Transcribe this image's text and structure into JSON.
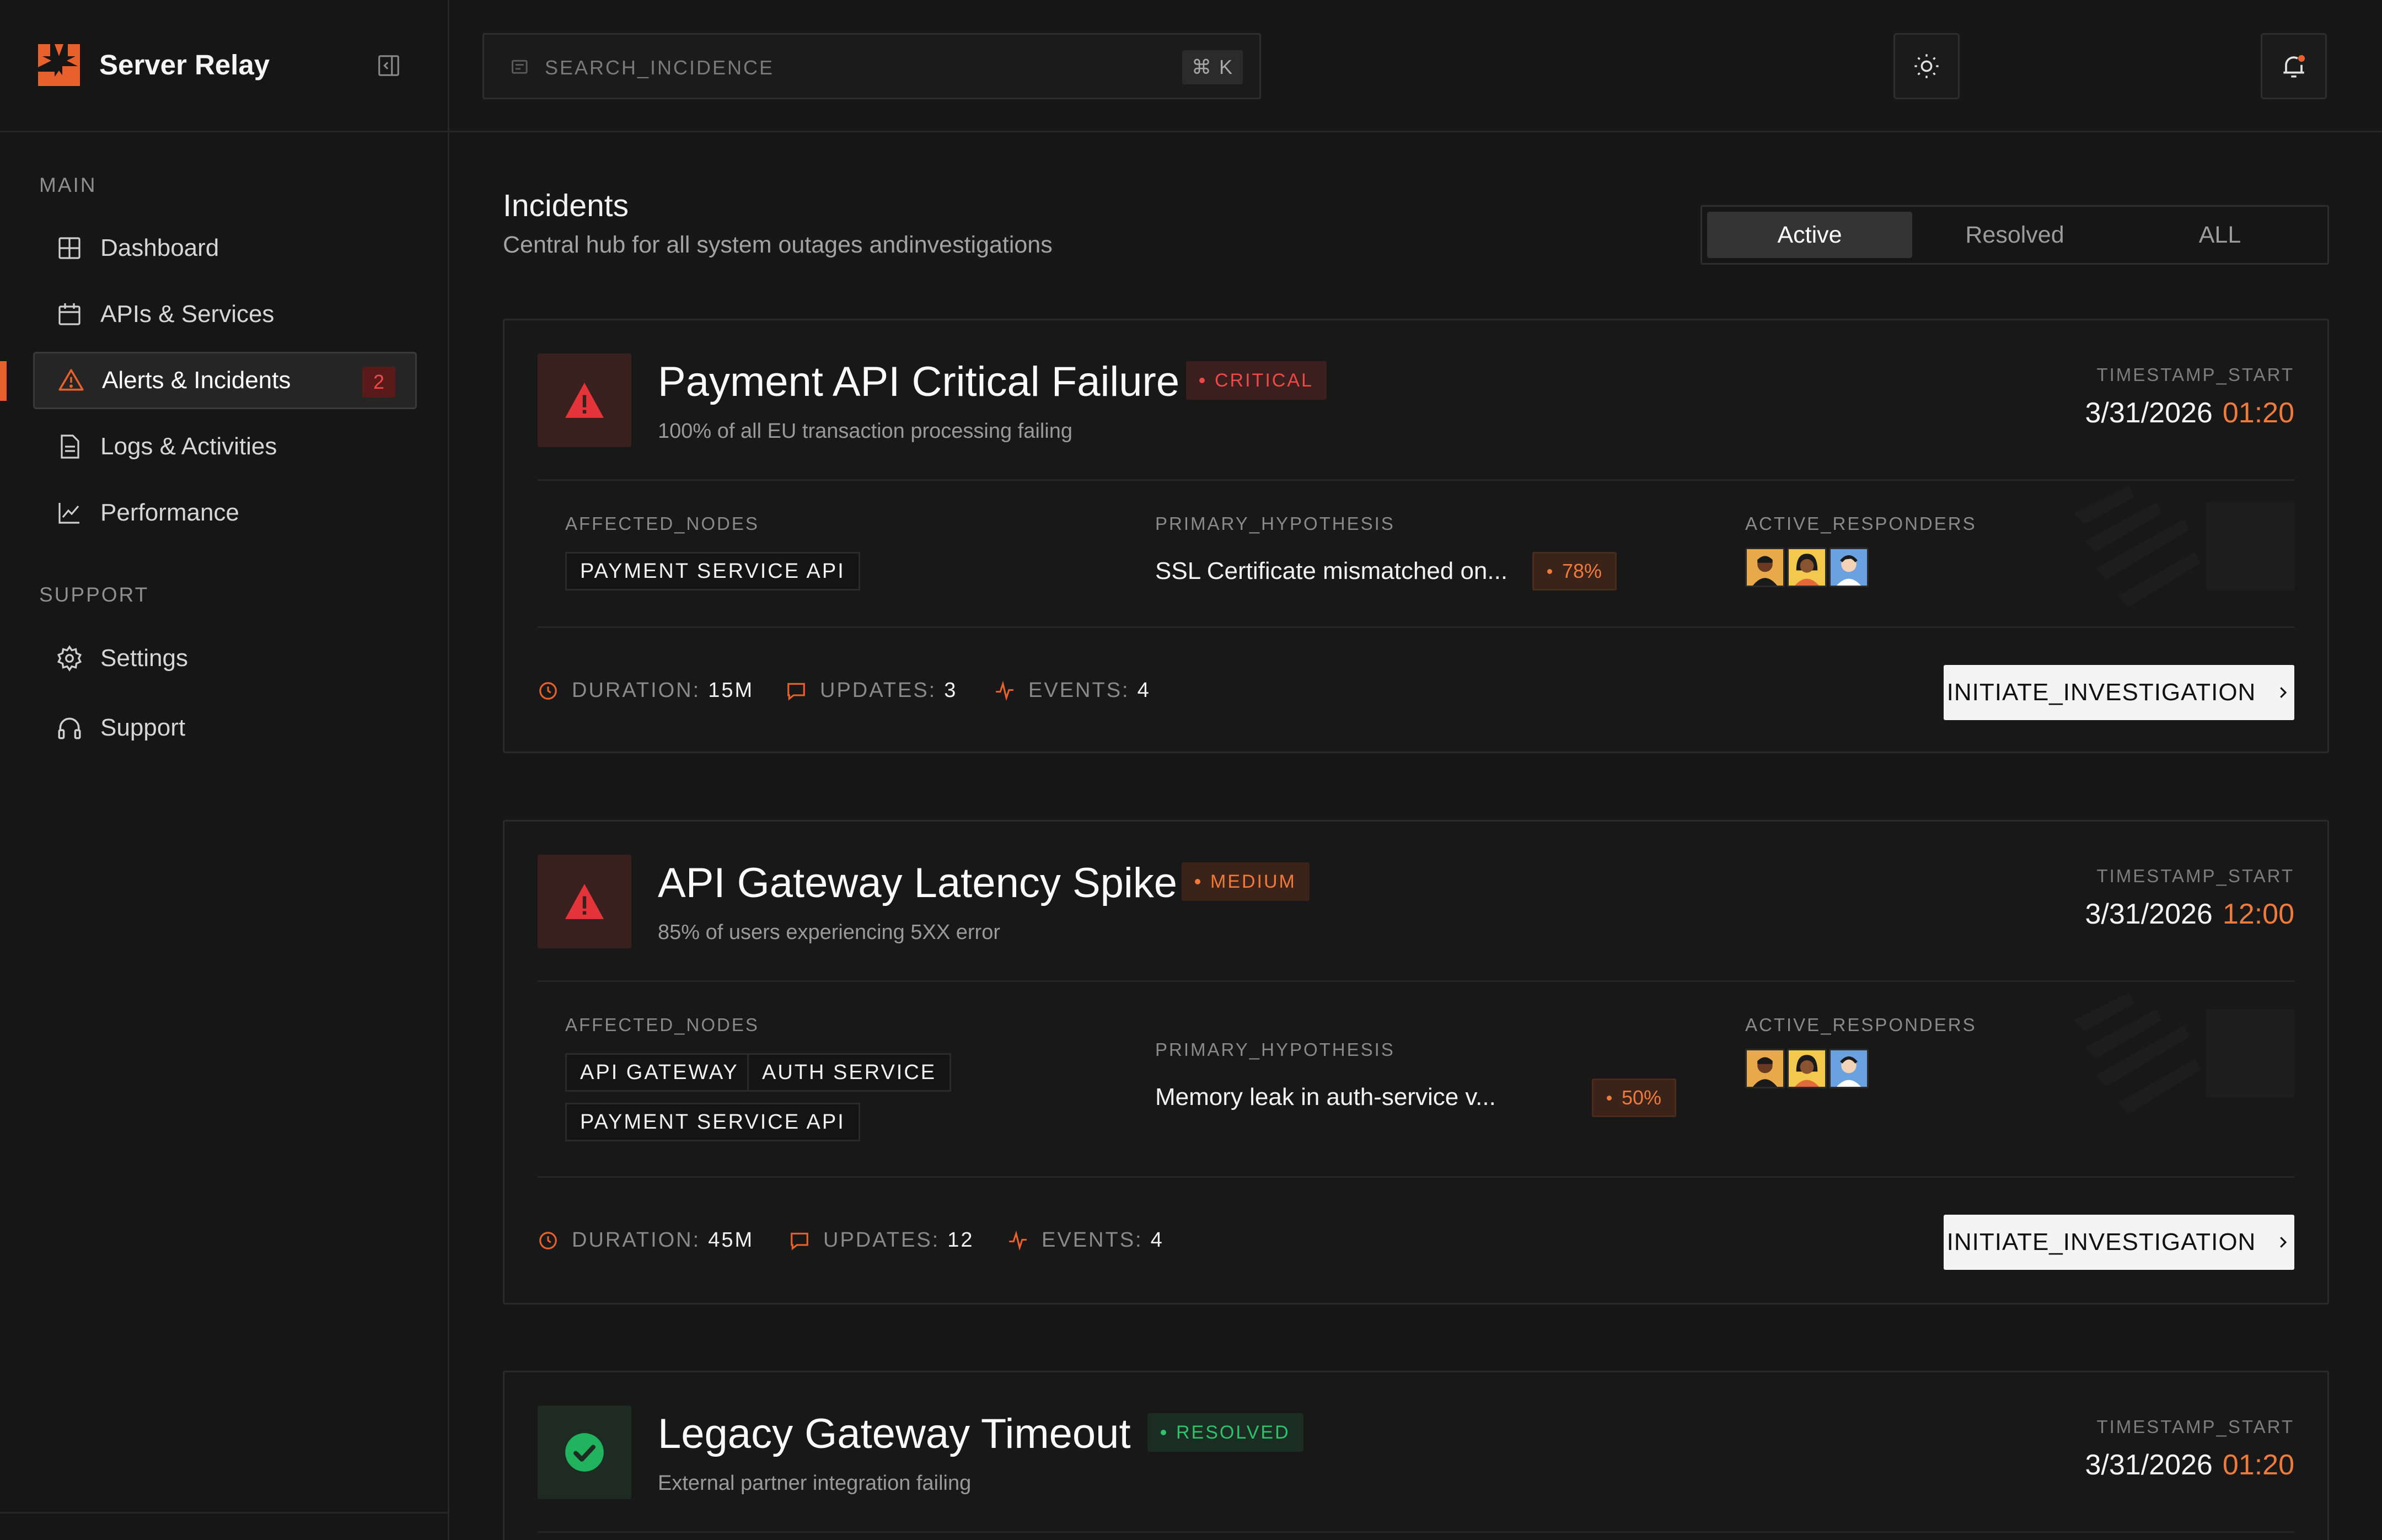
{
  "app": {
    "name": "Server Relay",
    "brand_color": "#e8612c"
  },
  "search": {
    "placeholder": "SEARCH_INCIDENCE",
    "shortcut": "⌘ K"
  },
  "sidebar": {
    "main_label": "MAIN",
    "support_label": "SUPPORT",
    "items": [
      {
        "label": "Dashboard",
        "icon": "grid-icon"
      },
      {
        "label": "APIs & Services",
        "icon": "calendar-icon"
      },
      {
        "label": "Alerts & Incidents",
        "icon": "warning-icon",
        "badge": "2",
        "active": true
      },
      {
        "label": "Logs & Activities",
        "icon": "document-icon"
      },
      {
        "label": "Performance",
        "icon": "chart-icon"
      }
    ],
    "support_items": [
      {
        "label": "Settings",
        "icon": "gear-icon"
      },
      {
        "label": "Support",
        "icon": "headphones-icon"
      }
    ]
  },
  "header": {
    "title": "Incidents",
    "subtitle": "Central hub for all system outages andinvestigations",
    "tabs": [
      "Active",
      "Resolved",
      "ALL"
    ],
    "active_tab": "Active"
  },
  "labels": {
    "timestamp": "TIMESTAMP_START",
    "affected": "AFFECTED_NODES",
    "hypothesis": "PRIMARY_HYPOTHESIS",
    "responders": "ACTIVE_RESPONDERS",
    "duration": "DURATION:",
    "updates": "UPDATES:",
    "events": "EVENTS:",
    "cta": "INITIATE_INVESTIGATION"
  },
  "incidents": [
    {
      "title": "Payment API Critical Failure",
      "severity": "CRITICAL",
      "subtitle": "100% of all EU transaction processing failing",
      "date": "3/31/2026",
      "time": "01:20",
      "nodes": [
        "PAYMENT SERVICE API"
      ],
      "hypothesis": "SSL Certificate mismatched on...",
      "confidence": "78%",
      "duration": "15M",
      "updates": "3",
      "events": "4"
    },
    {
      "title": "API Gateway Latency Spike",
      "severity": "MEDIUM",
      "subtitle": "85% of users experiencing 5XX error",
      "date": "3/31/2026",
      "time": "12:00",
      "nodes": [
        "API GATEWAY",
        "AUTH SERVICE",
        "PAYMENT SERVICE API"
      ],
      "hypothesis": "Memory leak in auth-service v...",
      "confidence": "50%",
      "duration": "45M",
      "updates": "12",
      "events": "4"
    },
    {
      "title": "Legacy Gateway Timeout",
      "severity": "RESOLVED",
      "subtitle": "External partner integration failing",
      "date": "3/31/2026",
      "time": "01:20"
    }
  ]
}
